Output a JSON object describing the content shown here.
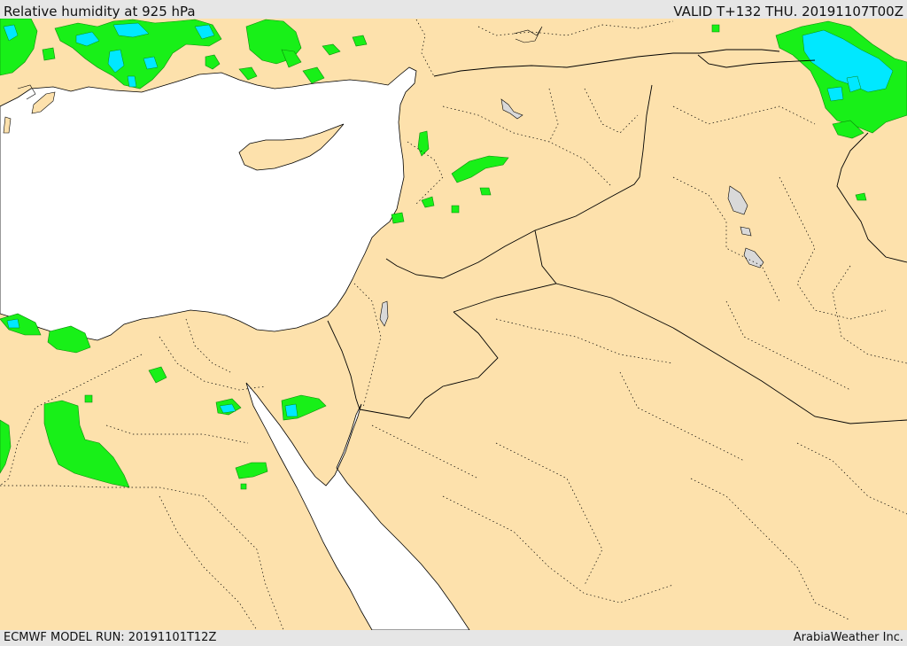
{
  "header": {
    "title": "Relative humidity at 925 hPa",
    "valid": "VALID T+132 THU. 20191107T00Z"
  },
  "footer": {
    "model_run": "ECMWF MODEL RUN: 20191101T12Z",
    "credit": "ArabiaWeather Inc."
  },
  "colors": {
    "land": "#fde1ac",
    "sea": "#ffffff",
    "humid_green": "#18f018",
    "humid_cyan": "#00e8ff",
    "lake": "#d9d9d9"
  }
}
